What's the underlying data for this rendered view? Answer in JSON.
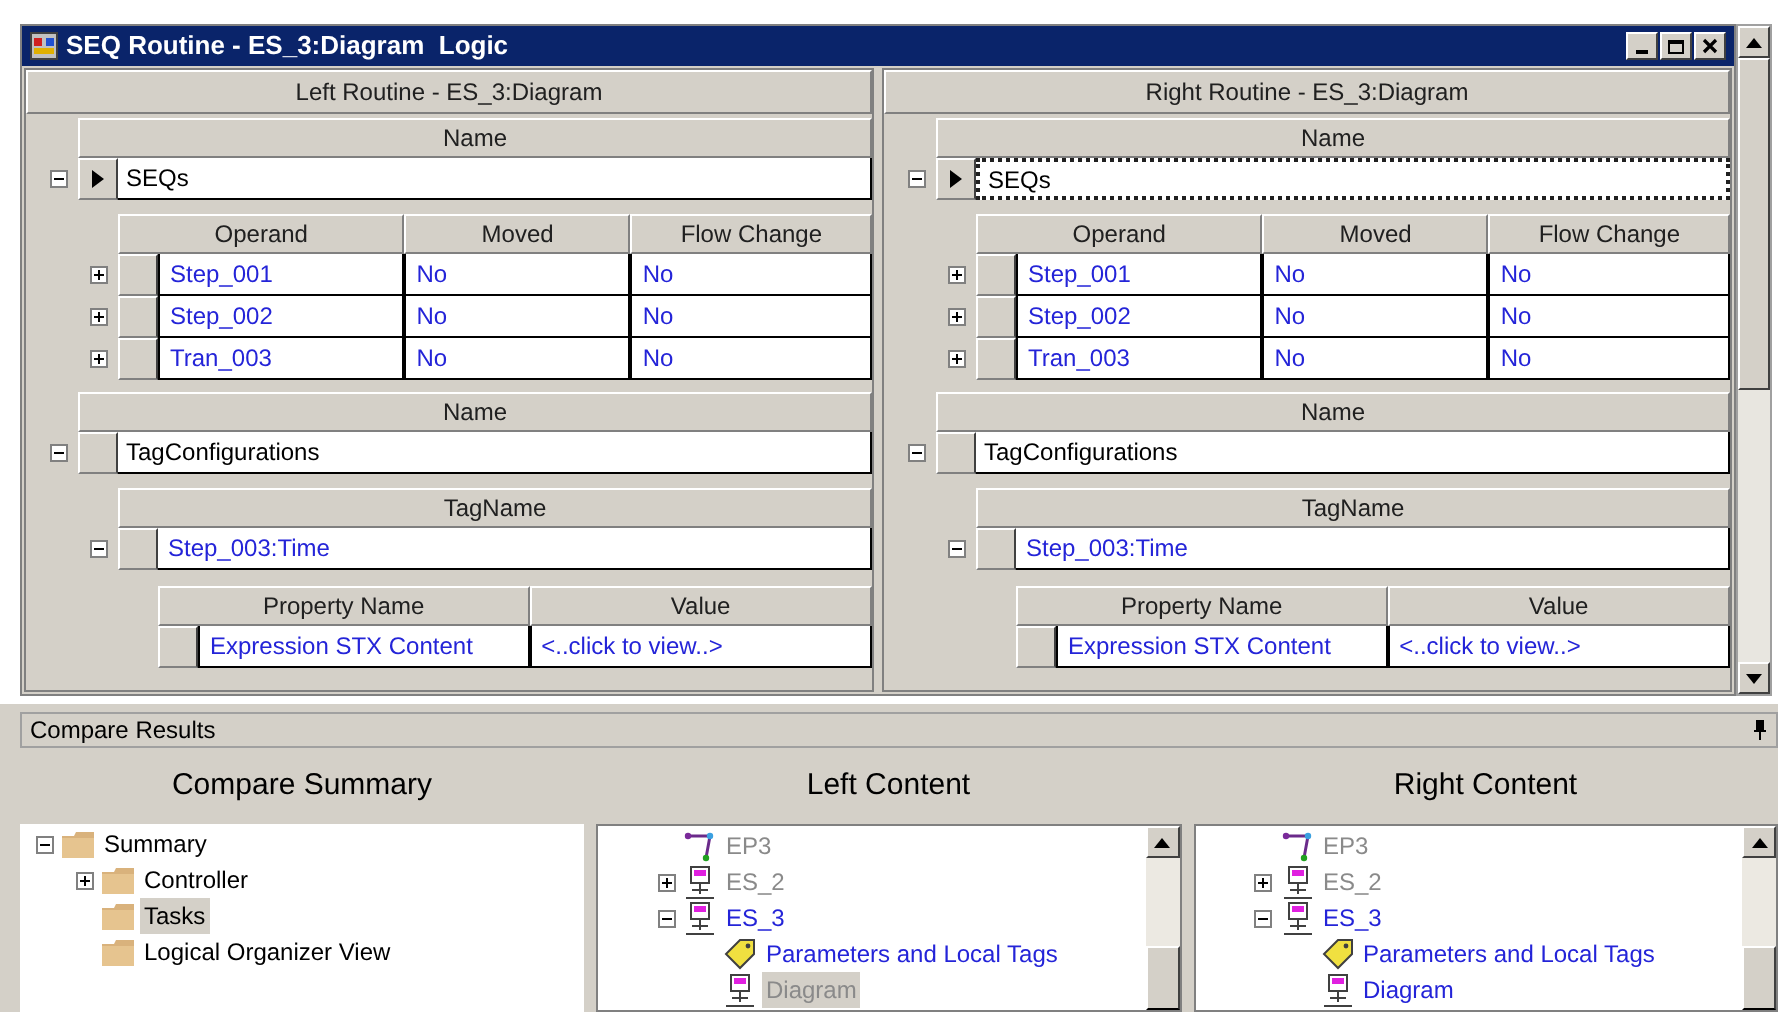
{
  "window": {
    "title": "SEQ Routine - ES_3:Diagram  Logic"
  },
  "routines": [
    {
      "title": "Left Routine - ES_3:Diagram",
      "groups": [
        {
          "kind": "seqs",
          "header": "Name",
          "name": "SEQs",
          "expanded": true,
          "current": true,
          "focused": false,
          "columns": [
            "Operand",
            "Moved",
            "Flow Change"
          ],
          "rows": [
            {
              "cells": [
                "Step_001",
                "No",
                "No"
              ],
              "expanded": false
            },
            {
              "cells": [
                "Step_002",
                "No",
                "No"
              ],
              "expanded": false
            },
            {
              "cells": [
                "Tran_003",
                "No",
                "No"
              ],
              "expanded": false
            }
          ]
        },
        {
          "kind": "tags",
          "header": "Name",
          "name": "TagConfigurations",
          "expanded": true,
          "current": false,
          "focused": false,
          "tag_header": "TagName",
          "tags": [
            {
              "name": "Step_003:Time",
              "expanded": true,
              "columns": [
                "Property Name",
                "Value"
              ],
              "rows": [
                {
                  "cells": [
                    "Expression STX Content",
                    "<..click to view..>"
                  ]
                }
              ]
            }
          ]
        }
      ]
    },
    {
      "title": "Right Routine - ES_3:Diagram",
      "groups": [
        {
          "kind": "seqs",
          "header": "Name",
          "name": "SEQs",
          "expanded": true,
          "current": true,
          "focused": true,
          "columns": [
            "Operand",
            "Moved",
            "Flow Change"
          ],
          "rows": [
            {
              "cells": [
                "Step_001",
                "No",
                "No"
              ],
              "expanded": false
            },
            {
              "cells": [
                "Step_002",
                "No",
                "No"
              ],
              "expanded": false
            },
            {
              "cells": [
                "Tran_003",
                "No",
                "No"
              ],
              "expanded": false
            }
          ]
        },
        {
          "kind": "tags",
          "header": "Name",
          "name": "TagConfigurations",
          "expanded": true,
          "current": false,
          "focused": false,
          "tag_header": "TagName",
          "tags": [
            {
              "name": "Step_003:Time",
              "expanded": true,
              "columns": [
                "Property Name",
                "Value"
              ],
              "rows": [
                {
                  "cells": [
                    "Expression STX Content",
                    "<..click to view..>"
                  ]
                }
              ]
            }
          ]
        }
      ]
    }
  ],
  "compare_results": {
    "title": "Compare Results",
    "panes": [
      {
        "title": "Compare Summary",
        "items": [
          {
            "label": "Summary",
            "kind": "folder",
            "expanded": true,
            "changed": false,
            "selected": false,
            "children": [
              {
                "label": "Controller",
                "kind": "folder",
                "expanded": false,
                "changed": false,
                "selected": false
              },
              {
                "label": "Tasks",
                "kind": "folder",
                "changed": false,
                "selected": true
              },
              {
                "label": "Logical Organizer View",
                "kind": "folder",
                "changed": false,
                "selected": false
              }
            ]
          }
        ]
      },
      {
        "title": "Left Content",
        "items": [
          {
            "label": "EP3",
            "kind": "endpoint",
            "changed": false,
            "selected": false
          },
          {
            "label": "ES_2",
            "kind": "step",
            "expanded": false,
            "changed": false,
            "selected": false
          },
          {
            "label": "ES_3",
            "kind": "step",
            "expanded": true,
            "changed": true,
            "selected": false,
            "children": [
              {
                "label": "Parameters and Local Tags",
                "kind": "tag",
                "changed": true,
                "selected": false
              },
              {
                "label": "Diagram",
                "kind": "step",
                "changed": false,
                "selected": true
              }
            ]
          }
        ]
      },
      {
        "title": "Right Content",
        "items": [
          {
            "label": "EP3",
            "kind": "endpoint",
            "changed": false,
            "selected": false
          },
          {
            "label": "ES_2",
            "kind": "step",
            "expanded": false,
            "changed": false,
            "selected": false
          },
          {
            "label": "ES_3",
            "kind": "step",
            "expanded": true,
            "changed": true,
            "selected": false,
            "children": [
              {
                "label": "Parameters and Local Tags",
                "kind": "tag",
                "changed": true,
                "selected": false
              },
              {
                "label": "Diagram",
                "kind": "step",
                "changed": true,
                "selected": false
              }
            ]
          }
        ]
      }
    ]
  }
}
